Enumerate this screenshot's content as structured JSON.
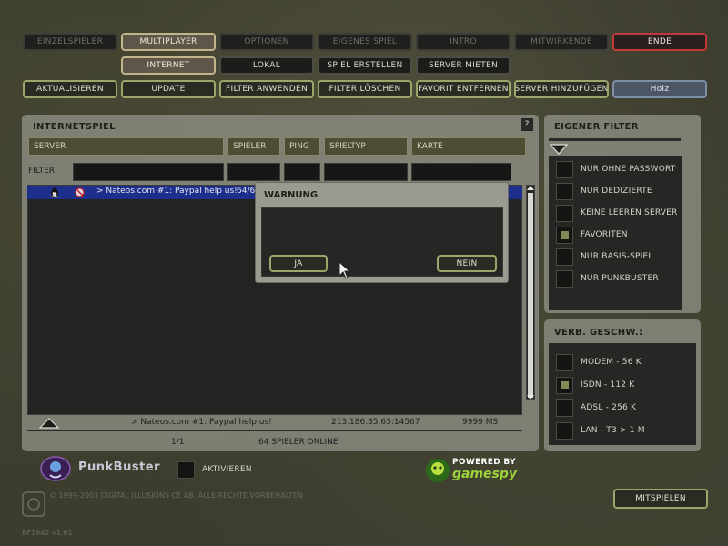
{
  "top_nav": {
    "einzelspieler": "EINZELSPIELER",
    "multiplayer": "MULTIPLAYER",
    "optionen": "OPTIONEN",
    "eigenes_spiel": "EIGENES SPIEL",
    "intro": "INTRO",
    "mitwirkende": "MITWIRKENDE",
    "ende": "ENDE"
  },
  "sub_nav": {
    "internet": "INTERNET",
    "lokal": "LOKAL",
    "spiel_erstellen": "SPIEL ERSTELLEN",
    "server_mieten": "SERVER MIETEN"
  },
  "actions": {
    "aktualisieren": "AKTUALISIEREN",
    "update": "UPDATE",
    "filter_anwenden": "FILTER ANWENDEN",
    "filter_loeschen": "FILTER LÖSCHEN",
    "favorit_entfernen": "FAVORIT ENTFERNEN",
    "server_hinzufuegen": "SERVER HINZUFÜGEN",
    "profile": "Holz"
  },
  "internet_panel": {
    "title": "INTERNETSPIEL",
    "help": "?",
    "columns": [
      "SERVER",
      "SPIELER",
      "PING",
      "SPIELTYP",
      "KARTE"
    ],
    "filter_label": "FILTER",
    "row": {
      "name": "> Nateos.com #1: Paypal help us!",
      "players": "64/6"
    },
    "status": {
      "server": "> Nateos.com #1: Paypal help us!",
      "address": "213.186.35.63:14567",
      "ping": "9999 MS"
    },
    "footer": {
      "page": "1/1",
      "online": "64 SPIELER ONLINE"
    }
  },
  "dialog": {
    "title": "WARNUNG",
    "yes": "JA",
    "no": "NEIN"
  },
  "own_filter": {
    "title": "EIGENER FILTER",
    "options": [
      {
        "label": "NUR OHNE PASSWORT",
        "checked": false
      },
      {
        "label": "NUR DEDIZIERTE",
        "checked": false
      },
      {
        "label": "KEINE LEEREN SERVER",
        "checked": false
      },
      {
        "label": "FAVORITEN",
        "checked": true
      },
      {
        "label": "NUR BASIS-SPIEL",
        "checked": false
      },
      {
        "label": "NUR PUNKBUSTER",
        "checked": false
      }
    ]
  },
  "speed": {
    "title": "VERB. GESCHW.:",
    "options": [
      {
        "label": "MODEM - 56 K",
        "checked": false
      },
      {
        "label": "ISDN - 112 K",
        "checked": true
      },
      {
        "label": "ADSL - 256 K",
        "checked": false
      },
      {
        "label": "LAN - T3 > 1 M",
        "checked": false
      }
    ]
  },
  "punkbuster": {
    "logo": "PunkBuster",
    "activate_label": "AKTIVIEREN"
  },
  "gamespy": {
    "powered": "POWERED BY",
    "name": "gamespy"
  },
  "copyright": "© 1999-2003 DIGITAL ILLUSIONS CE AB. ALLE RECHTE VORBEHALTEN.",
  "version": "BF1942 v1.61",
  "join_button": "MITSPIELEN",
  "colors": {
    "accent_green": "#9aa66a",
    "accent_gold": "#c2b58a",
    "accent_red": "#c0393a",
    "selection_blue": "#1c2f8c"
  }
}
